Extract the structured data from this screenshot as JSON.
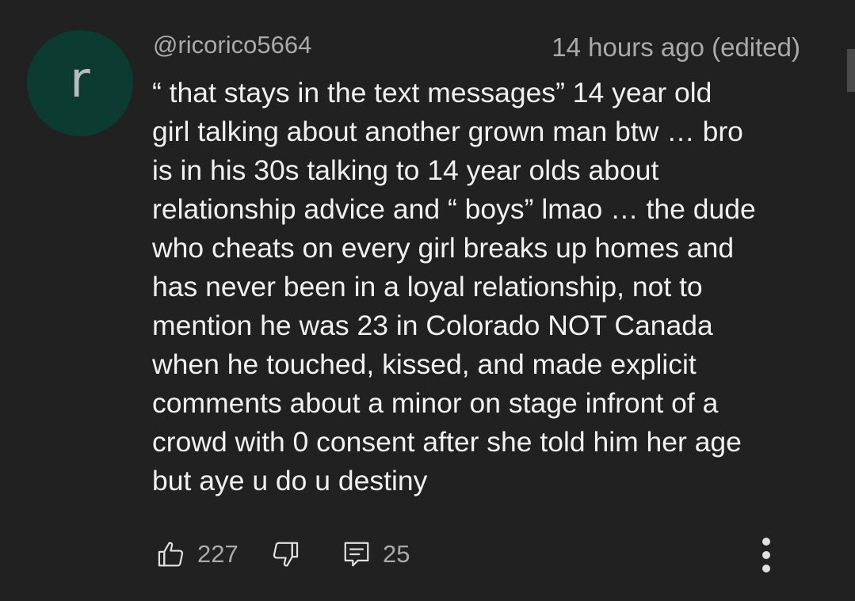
{
  "comment": {
    "author": "@ricorico5664",
    "avatar_letter": "r",
    "timestamp": "14 hours ago (edited)",
    "lines": [
      "“ that stays in the text messages” 14 year old",
      "girl talking about another grown man btw … bro",
      "is in his 30s talking to 14 year olds about",
      "relationship advice and “ boys” lmao … the dude",
      "who cheats on every girl breaks up homes and",
      "has never been in a loyal relationship, not to",
      "mention he was 23 in Colorado NOT Canada",
      "when he touched, kissed, and made explicit",
      "comments about a minor on stage infront of a",
      "crowd with 0 consent after she told him her age",
      "but aye u do u destiny"
    ]
  },
  "actions": {
    "like_count": "227",
    "reply_count": "25",
    "like_icon": "thumbs-up-icon",
    "dislike_icon": "thumbs-down-icon",
    "reply_icon": "reply-comment-icon",
    "more_icon": "more-vertical-icon"
  },
  "colors": {
    "background": "#212121",
    "avatar": "#0b3b31",
    "text": "#f1f1f1",
    "muted": "#aaaaaa"
  }
}
